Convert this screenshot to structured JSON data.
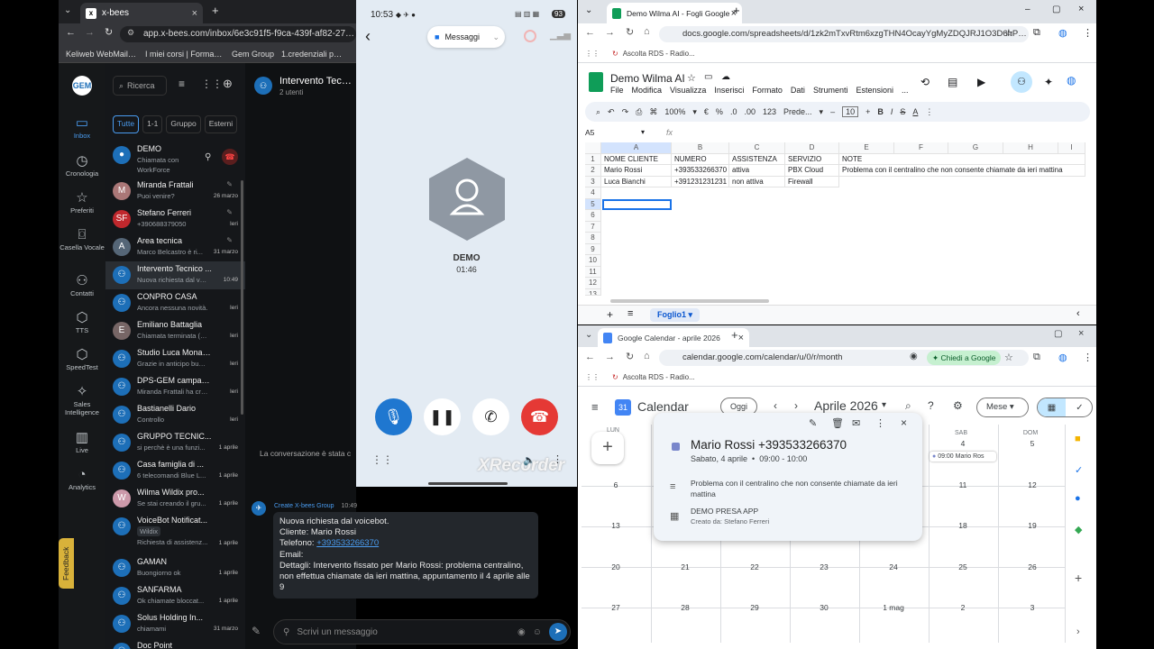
{
  "dark_browser": {
    "tab_title": "x-bees",
    "url": "app.x-bees.com/inbox/6e3c91f5-f9ca-439f-af82-275ae969",
    "bookmarks": [
      "Keliweb WebMail :...",
      "I miei corsi | Formaz...",
      "Gem Group",
      "1.credenziali pbx cl..."
    ]
  },
  "xbees": {
    "rail": [
      {
        "label": "Inbox",
        "icon": "inbox-icon"
      },
      {
        "label": "Cronologia",
        "icon": "clock-icon"
      },
      {
        "label": "Preferiti",
        "icon": "star-icon"
      },
      {
        "label": "Casella Vocale",
        "icon": "voicemail-icon"
      },
      {
        "label": "Contatti",
        "icon": "contacts-icon"
      },
      {
        "label": "TTS",
        "icon": "tts-icon"
      },
      {
        "label": "SpeedTest",
        "icon": "speedtest-icon"
      },
      {
        "label": "Sales Intelligence",
        "icon": "sales-icon"
      },
      {
        "label": "Live",
        "icon": "live-icon"
      },
      {
        "label": "Analytics",
        "icon": "analytics-icon"
      }
    ],
    "feedback": "Feedback",
    "search_placeholder": "Ricerca",
    "filters": [
      "Tutte",
      "1-1",
      "Gruppo",
      "Esterni"
    ],
    "chats": [
      {
        "name": "DEMO",
        "sub": "Chiamata con",
        "sub2": "WorkForce",
        "time": ""
      },
      {
        "name": "Miranda Frattali",
        "sub": "Puoi venire?",
        "time": "26 marzo"
      },
      {
        "name": "Stefano Ferreri",
        "sub": "+390688379050",
        "time": "Ieri"
      },
      {
        "name": "Area tecnica",
        "sub": "Marco Belcastro è ri...",
        "time": "31 marzo"
      },
      {
        "name": "Intervento Tecnico ...",
        "sub": "Nuova richiesta dal voi...",
        "time": "10:49"
      },
      {
        "name": "CONPRO CASA",
        "sub": "Ancora nessuna novità.",
        "time": "Ieri"
      },
      {
        "name": "Emiliano Battaglia",
        "sub": "Chiamata terminata (00:...",
        "time": "Ieri"
      },
      {
        "name": "Studio Luca Monaco ...",
        "sub": "Grazie in anticipo buon l...",
        "time": "Ieri"
      },
      {
        "name": "DPS-GEM campagne...",
        "sub": "Miranda Frattali ha creat...",
        "time": "Ieri"
      },
      {
        "name": "Bastianelli Dario",
        "sub": "Controllo",
        "time": "Ieri"
      },
      {
        "name": "GRUPPO TECNIC...",
        "sub": "si perchè è una funzi...",
        "time": "1 aprile"
      },
      {
        "name": "Casa famiglia di ...",
        "sub": "6 telecomandi Blue L...",
        "time": "1 aprile"
      },
      {
        "name": "Wilma Wildix pro...",
        "sub": "Se stai creando il gru...",
        "time": "1 aprile"
      },
      {
        "name": "VoiceBot Notificat...",
        "sub": "Wildix",
        "sub2": "Richiesta di assistenz...",
        "time": "1 aprile"
      },
      {
        "name": "GAMAN",
        "sub": "Buongiorno ok",
        "time": "1 aprile"
      },
      {
        "name": "SANFARMA",
        "sub": "Ok chiamate bloccat...",
        "time": "1 aprile"
      },
      {
        "name": "Solus Holding In...",
        "sub": "chiamami",
        "time": "31 marzo"
      },
      {
        "name": "Doc Point",
        "sub": "",
        "time": ""
      }
    ],
    "conv_title": "Intervento Tecnico",
    "conv_sub": "2 utenti",
    "conv_notice": "La conversazione è stata c",
    "msg_sender": "Create X-bees Group",
    "msg_time": "10:49",
    "msg_lines": [
      "Nuova richiesta dal voicebot.",
      "Cliente: Mario Rossi",
      "Telefono: ",
      "Email:",
      "Dettagli: Intervento fissato per Mario Rossi: problema centralino, non effettua chiamate da ieri mattina, appuntamento il 4 aprile alle 9"
    ],
    "msg_phone": "+393533266370",
    "input_placeholder": "Scrivi un messaggio"
  },
  "phone": {
    "time": "10:53",
    "battery": "93",
    "app_label": "Messaggi",
    "caller": "DEMO",
    "duration": "01:46",
    "watermark": "XRecorder"
  },
  "sheets": {
    "tab_title": "Demo Wilma AI - Fogli Google",
    "url": "docs.google.com/spreadsheets/d/1zk2mTxvRtm6xzgTHN4OcayYgMyZDQJRJ1O3D6hPUYus/...",
    "bookmark": "Ascolta RDS - Radio...",
    "doc_title": "Demo Wilma AI",
    "menus": [
      "File",
      "Modifica",
      "Visualizza",
      "Inserisci",
      "Formato",
      "Dati",
      "Strumenti",
      "Estensioni",
      "..."
    ],
    "zoom": "100%",
    "font": "Prede...",
    "font_size": "10",
    "cell_ref": "A5",
    "columns": [
      "A",
      "B",
      "C",
      "D",
      "E",
      "F",
      "G",
      "H",
      "I"
    ],
    "rows": [
      [
        "NOME CLIENTE",
        "NUMERO",
        "ASSISTENZA",
        "SERVIZIO",
        "NOTE"
      ],
      [
        "Mario Rossi",
        "+393533266370",
        "attiva",
        "PBX Cloud",
        "Problema con il centralino che non consente chiamate da ieri mattina"
      ],
      [
        "Luca Bianchi",
        "+391231231231",
        "non attiva",
        "Firewall",
        ""
      ]
    ],
    "row_numbers": [
      "1",
      "2",
      "3",
      "4",
      "5",
      "6",
      "7",
      "8",
      "9",
      "10",
      "11",
      "12",
      "13"
    ],
    "sheet_tab": "Foglio1"
  },
  "calendar": {
    "tab_title": "Google Calendar - aprile 2026",
    "url": "calendar.google.com/calendar/u/0/r/month",
    "ask_google": "Chiedi a Google",
    "bookmark": "Ascolta RDS - Radio...",
    "app_name": "Calendar",
    "today_btn": "Oggi",
    "month": "Aprile 2026",
    "view": "Mese",
    "weekday_sab": "SAB",
    "weekday_dom": "DOM",
    "weekday_lun": "LUN",
    "weeks": [
      [
        "",
        "",
        "",
        "",
        "",
        "4",
        "5"
      ],
      [
        "6",
        "",
        "",
        "",
        "",
        "11",
        "12"
      ],
      [
        "13",
        "",
        "",
        "",
        "",
        "18",
        "19"
      ],
      [
        "20",
        "21",
        "22",
        "23",
        "24",
        "25",
        "26"
      ],
      [
        "27",
        "28",
        "29",
        "30",
        "1 mag",
        "2",
        "3"
      ]
    ],
    "chip": "09:00 Mario Ros",
    "popup": {
      "title": "Mario Rossi +393533266370",
      "when": "Sabato, 4 aprile  •  09:00 - 10:00",
      "desc": "Problema con il centralino che non consente chiamate da ieri mattina",
      "cal_name": "DEMO PRESA APP",
      "creator": "Creato da: Stefano Ferreri"
    }
  }
}
